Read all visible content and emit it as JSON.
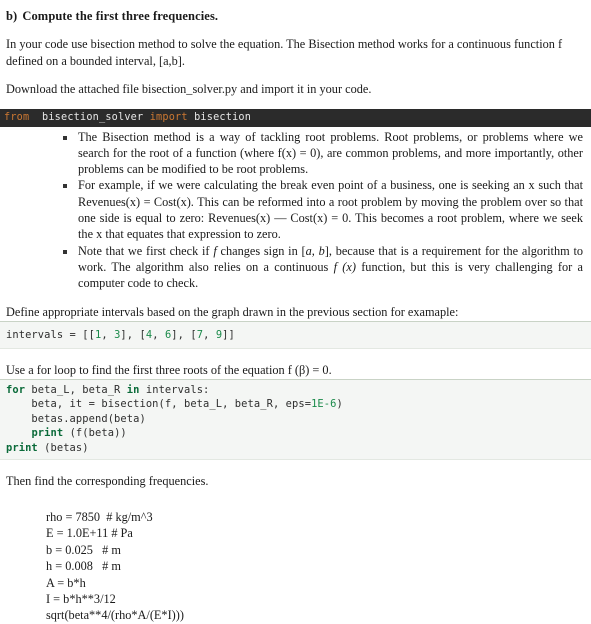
{
  "document": {
    "section_heading": {
      "label": "b)",
      "text": "Compute the first three frequencies."
    },
    "paragraphs": {
      "intro": "In your code use bisection method to solve the equation. The Bisection method works for a continuous function f defined on a bounded interval, [a,b].",
      "download": "Download the attached file bisection_solver.py and import it in your code.",
      "define_intervals": "Define appropriate intervals based on the graph drawn in the previous section for examaple:",
      "use_for_loop_pre": "Use a for loop to find the first three roots of the equation f (β) = 0.",
      "then_find": "Then find the corresponding frequencies."
    },
    "code_import": {
      "theme": "dark",
      "background": "#2b2b2b",
      "keyword_color": "#cc7832",
      "identifier_color": "#e8e8e8",
      "kw_from": "from",
      "module": "bisection_solver",
      "kw_import": "import",
      "name": "bisection",
      "full_line": "from  bisection_solver import bisection"
    },
    "bullets": [
      {
        "text": "The Bisection method is a way of tackling root problems. Root problems, or problems where we search for the root of a function (where f(x) = 0), are common problems, and more importantly, other problems can be modified to be root problems."
      },
      {
        "text": "For example, if we were calculating the break even point of a business, one is seeking an x such that Revenues(x) = Cost(x). This can be reformed into a root problem by moving the problem over so that one side is equal to zero: Revenues(x) — Cost(x) = 0. This becomes a root problem, where we seek the x that equates that expression to zero."
      },
      {
        "part1": "Note that we first check if ",
        "italic1": "f",
        "part2": " changes sign in [",
        "italic2": "a, b",
        "part3": "], because that is a requirement for the algorithm to work. The algorithm also relies on a continuous ",
        "italic3": "f (x)",
        "part4": " function, but this is very challenging for a computer code to check."
      }
    ],
    "code_intervals": {
      "theme": "light",
      "background": "#f4f6f4",
      "number_color": "#1a8a4a",
      "prefix": "intervals = [[",
      "full_line": "intervals = [[1, 3], [4, 6], [7, 9]]",
      "values": [
        [
          1,
          3
        ],
        [
          4,
          6
        ],
        [
          7,
          9
        ]
      ]
    },
    "code_loop": {
      "theme": "light",
      "background": "#f4f6f4",
      "keyword_color": "#0b6b3a",
      "number_color": "#1a8a4a",
      "lines": [
        {
          "kw": "for",
          "rest": " beta_L, beta_R ",
          "kw2": "in",
          "rest2": " intervals:"
        },
        {
          "plain": "    beta, it = bisection(f, beta_L, beta_R, eps=",
          "num": "1E-6",
          "tail": ")"
        },
        {
          "plain": "    betas.append(beta)"
        },
        {
          "indent": "    ",
          "kw": "print",
          "rest": " (f(beta))"
        },
        {
          "kw": "print",
          "rest": " (betas)"
        }
      ],
      "full_text": "for beta_L, beta_R in intervals:\n    beta, it = bisection(f, beta_L, beta_R, eps=1E-6)\n    betas.append(beta)\n    print (f(beta))\nprint (betas)"
    },
    "parameters": {
      "lines": [
        "rho = 7850  # kg/m^3",
        "E = 1.0E+11 # Pa",
        "b = 0.025   # m",
        "h = 0.008   # m",
        "A = b*h",
        "I = b*h**3/12",
        "sqrt(beta**4/(rho*A/(E*I)))"
      ],
      "text": "rho = 7850  # kg/m^3\nE = 1.0E+11 # Pa\nb = 0.025   # m\nh = 0.008   # m\nA = b*h\nI = b*h**3/12\nsqrt(beta**4/(rho*A/(E*I)))"
    }
  }
}
